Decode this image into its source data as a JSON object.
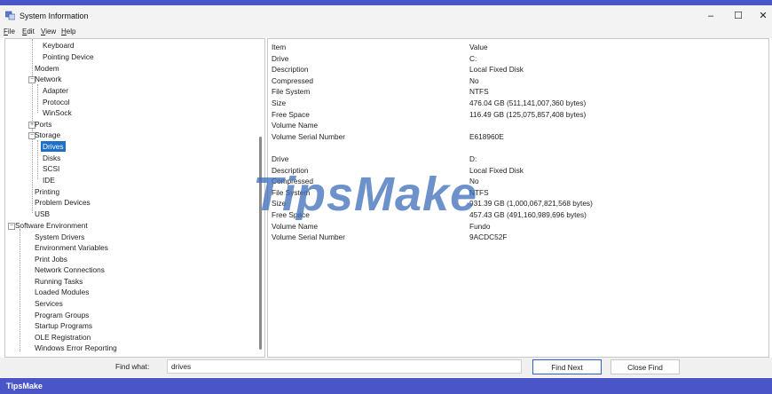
{
  "window": {
    "title": "System Information",
    "minimize": "–",
    "maximize": "☐",
    "close": "✕"
  },
  "menu": [
    "File",
    "Edit",
    "View",
    "Help"
  ],
  "tree": [
    {
      "label": "Keyboard"
    },
    {
      "label": "Pointing Device"
    },
    {
      "label": "Modem"
    },
    {
      "label": "Network"
    },
    {
      "label": "Adapter"
    },
    {
      "label": "Protocol"
    },
    {
      "label": "WinSock"
    },
    {
      "label": "Ports"
    },
    {
      "label": "Storage"
    },
    {
      "label": "Drives"
    },
    {
      "label": "Disks"
    },
    {
      "label": "SCSI"
    },
    {
      "label": "IDE"
    },
    {
      "label": "Printing"
    },
    {
      "label": "Problem Devices"
    },
    {
      "label": "USB"
    },
    {
      "label": "Software Environment"
    },
    {
      "label": "System Drivers"
    },
    {
      "label": "Environment Variables"
    },
    {
      "label": "Print Jobs"
    },
    {
      "label": "Network Connections"
    },
    {
      "label": "Running Tasks"
    },
    {
      "label": "Loaded Modules"
    },
    {
      "label": "Services"
    },
    {
      "label": "Program Groups"
    },
    {
      "label": "Startup Programs"
    },
    {
      "label": "OLE Registration"
    },
    {
      "label": "Windows Error Reporting"
    }
  ],
  "details": {
    "header": {
      "item": "Item",
      "value": "Value"
    },
    "rows": [
      {
        "item": "Drive",
        "value": "C:"
      },
      {
        "item": "Description",
        "value": "Local Fixed Disk"
      },
      {
        "item": "Compressed",
        "value": "No"
      },
      {
        "item": "File System",
        "value": "NTFS"
      },
      {
        "item": "Size",
        "value": "476.04 GB (511,141,007,360 bytes)"
      },
      {
        "item": "Free Space",
        "value": "116.49 GB (125,075,857,408 bytes)"
      },
      {
        "item": "Volume Name",
        "value": ""
      },
      {
        "item": "Volume Serial Number",
        "value": "E618960E"
      },
      {
        "item": "",
        "value": ""
      },
      {
        "item": "Drive",
        "value": "D:"
      },
      {
        "item": "Description",
        "value": "Local Fixed Disk"
      },
      {
        "item": "Compressed",
        "value": "No"
      },
      {
        "item": "File System",
        "value": "NTFS"
      },
      {
        "item": "Size",
        "value": "931.39 GB (1,000,067,821,568 bytes)"
      },
      {
        "item": "Free Space",
        "value": "457.43 GB (491,160,989,696 bytes)"
      },
      {
        "item": "Volume Name",
        "value": "Fundo"
      },
      {
        "item": "Volume Serial Number",
        "value": "9ACDC52F"
      }
    ]
  },
  "find": {
    "label": "Find what:",
    "value": "drives",
    "find_next": "Find Next",
    "close_find": "Close Find"
  },
  "watermark": "TipsMake",
  "footer": "TipsMake",
  "colors": {
    "accent": "#4a56c8",
    "selection": "#1d6fc7",
    "watermark": "#3c6eb9"
  }
}
